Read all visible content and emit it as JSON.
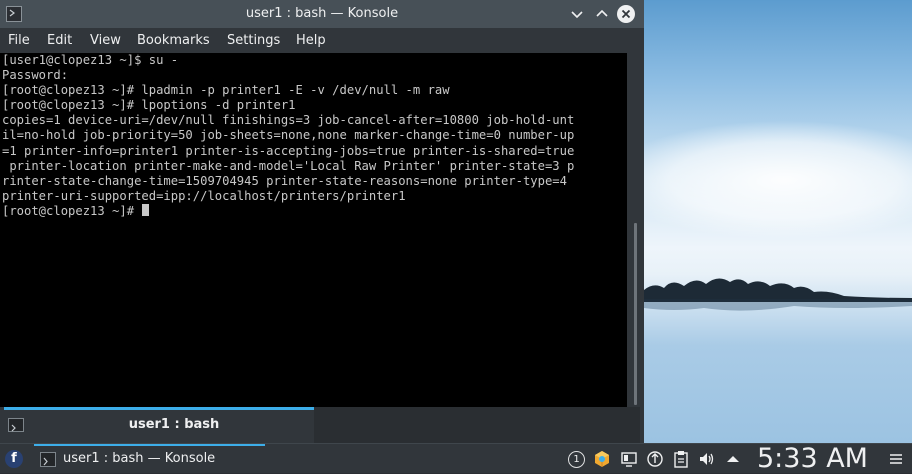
{
  "window": {
    "title": "user1 : bash — Konsole"
  },
  "menubar": {
    "items": [
      "File",
      "Edit",
      "View",
      "Bookmarks",
      "Settings",
      "Help"
    ]
  },
  "terminal": {
    "lines": [
      "[user1@clopez13 ~]$ su -",
      "Password:",
      "[root@clopez13 ~]# lpadmin -p printer1 -E -v /dev/null -m raw",
      "[root@clopez13 ~]# lpoptions -d printer1",
      "copies=1 device-uri=/dev/null finishings=3 job-cancel-after=10800 job-hold-unt",
      "il=no-hold job-priority=50 job-sheets=none,none marker-change-time=0 number-up",
      "=1 printer-info=printer1 printer-is-accepting-jobs=true printer-is-shared=true",
      " printer-location printer-make-and-model='Local Raw Printer' printer-state=3 p",
      "rinter-state-change-time=1509704945 printer-state-reasons=none printer-type=4",
      "printer-uri-supported=ipp://localhost/printers/printer1"
    ],
    "prompt": "[root@clopez13 ~]# "
  },
  "tab": {
    "label": "user1 : bash"
  },
  "taskbar": {
    "task_label": "user1 : bash — Konsole",
    "notification_count": "1",
    "clock": "5:33 AM"
  },
  "icons": {
    "launcher": "fedora-icon",
    "tray": [
      "notifications-icon",
      "updates-icon",
      "display-icon",
      "network-icon",
      "clipboard-icon",
      "volume-icon",
      "expand-tray-icon",
      "menu-icon"
    ]
  },
  "colors": {
    "accent": "#3daee9",
    "terminal_bg": "#000000",
    "terminal_fg": "#c8c8c8",
    "chrome": "#31363b"
  }
}
